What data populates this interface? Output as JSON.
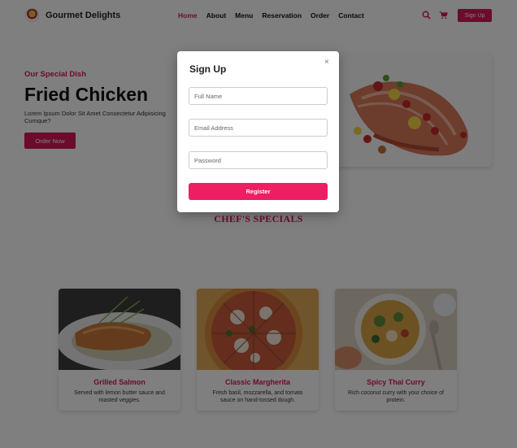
{
  "nav": {
    "brand": "Gourmet Delights",
    "links": [
      "Home",
      "About",
      "Menu",
      "Reservation",
      "Order",
      "Contact"
    ],
    "signup_label": "Sign Up"
  },
  "hero": {
    "subtitle": "Our Special Dish",
    "title": "Fried Chicken",
    "description": "Lorem Ipsum Dolor Sit Amet Consectetur Adipisicing Cumque?",
    "button": "Order Now"
  },
  "specials": {
    "title": "CHEF'S SPECIALS",
    "items": [
      {
        "title": "Grilled Salmon",
        "description": "Served with lemon butter sauce and roasted veggies."
      },
      {
        "title": "Classic Margherita",
        "description": "Fresh basil, mozzarella, and tomato sauce on hand-tossed dough."
      },
      {
        "title": "Spicy Thai Curry",
        "description": "Rich coconut curry with your choice of protein."
      }
    ]
  },
  "modal": {
    "title": "Sign Up",
    "close": "×",
    "full_name_placeholder": "Full Name",
    "email_placeholder": "Email Address",
    "password_placeholder": "Password",
    "register_label": "Register"
  },
  "colors": {
    "accent": "#d6175c",
    "register": "#ed1e62"
  }
}
